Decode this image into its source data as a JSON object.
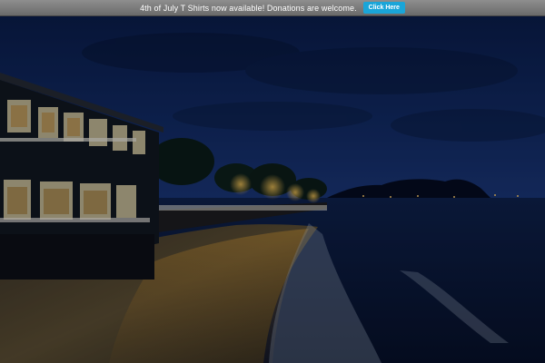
{
  "announcement": {
    "text": "4th of July T Shirts now available! Donations are welcome.",
    "button_label": "Click Here",
    "button_color": "#1aa5d8",
    "bar_color": "#7c7c7c"
  },
  "hero": {
    "image": "night-beach-waterfront-photo",
    "colors": {
      "sky": "#0d1d4a",
      "ocean": "#0a1838",
      "sand": "#6b5a3a",
      "lights": "#f0b040"
    }
  }
}
